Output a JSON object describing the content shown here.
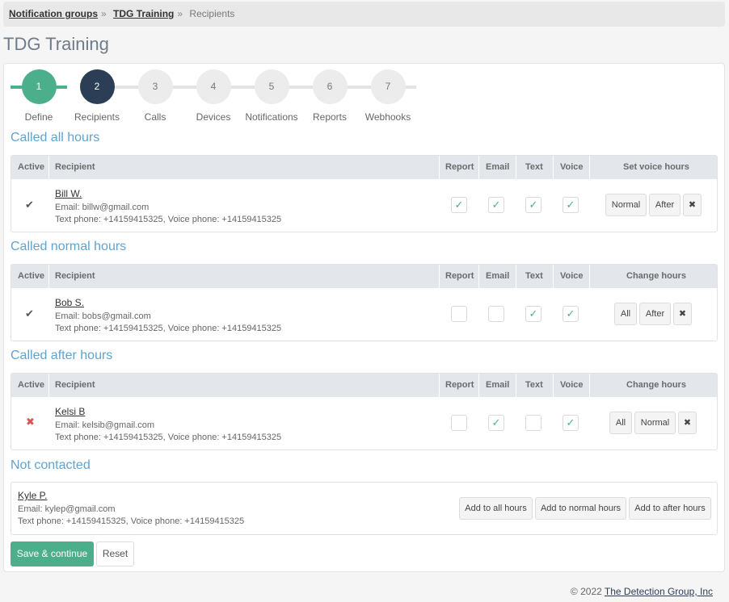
{
  "breadcrumb": {
    "items": [
      "Notification groups",
      "TDG Training"
    ],
    "current": "Recipients",
    "separator": "»"
  },
  "page": {
    "title": "TDG Training"
  },
  "steps": [
    {
      "num": "1",
      "label": "Define"
    },
    {
      "num": "2",
      "label": "Recipients"
    },
    {
      "num": "3",
      "label": "Calls"
    },
    {
      "num": "4",
      "label": "Devices"
    },
    {
      "num": "5",
      "label": "Notifications"
    },
    {
      "num": "6",
      "label": "Reports"
    },
    {
      "num": "7",
      "label": "Webhooks"
    }
  ],
  "columns": {
    "active": "Active",
    "recipient": "Recipient",
    "report": "Report",
    "email": "Email",
    "text": "Text",
    "voice": "Voice"
  },
  "sections": {
    "all": {
      "title": "Called all hours",
      "hours_header": "Set voice hours",
      "recipient": {
        "name": "Bill W.",
        "email": "Email: billw@gmail.com",
        "phones": "Text phone: +14159415325, Voice phone: +14159415325"
      },
      "checks": {
        "active": "✔",
        "report": "✓",
        "email": "✓",
        "text": "✓",
        "voice": "✓"
      },
      "buttons": [
        "Normal",
        "After",
        "✖"
      ]
    },
    "normal": {
      "title": "Called normal hours",
      "hours_header": "Change hours",
      "recipient": {
        "name": "Bob S.",
        "email": "Email: bobs@gmail.com",
        "phones": "Text phone: +14159415325, Voice phone: +14159415325"
      },
      "checks": {
        "active": "✔",
        "report": "",
        "email": "",
        "text": "✓",
        "voice": "✓"
      },
      "buttons": [
        "All",
        "After",
        "✖"
      ]
    },
    "after": {
      "title": "Called after hours",
      "hours_header": "Change hours",
      "recipient": {
        "name": "Kelsi B",
        "email": "Email: kelsib@gmail.com",
        "phones": "Text phone: +14159415325, Voice phone: +14159415325"
      },
      "checks": {
        "active": "✖",
        "report": "",
        "email": "✓",
        "text": "",
        "voice": "✓"
      },
      "buttons": [
        "All",
        "Normal",
        "✖"
      ]
    }
  },
  "not_contacted": {
    "title": "Not contacted",
    "recipient": {
      "name": "Kyle P.",
      "email": "Email: kylep@gmail.com",
      "phones": "Text phone: +14159415325, Voice phone: +14159415325"
    },
    "buttons": [
      "Add to all hours",
      "Add to normal hours",
      "Add to after hours"
    ]
  },
  "actions": {
    "save": "Save & continue",
    "reset": "Reset"
  },
  "footer": {
    "copyright": "© 2022",
    "company": "The Detection Group, Inc"
  },
  "colors": {
    "accent": "#4caf8c",
    "active_step": "#2c3e55",
    "section_title": "#5ea4cf",
    "danger": "#d9534f"
  }
}
